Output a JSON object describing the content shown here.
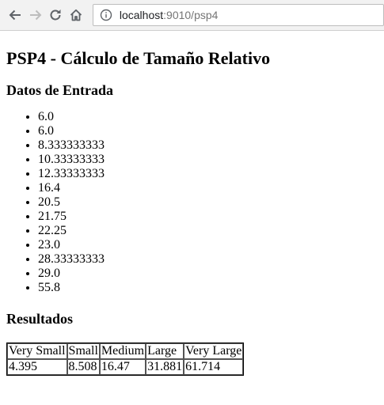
{
  "browser": {
    "url_host": "localhost",
    "url_rest": ":9010/psp4"
  },
  "page": {
    "title": "PSP4 - Cálculo de Tamaño Relativo",
    "input_heading": "Datos de Entrada",
    "inputs": [
      "6.0",
      "6.0",
      "8.333333333",
      "10.33333333",
      "12.33333333",
      "16.4",
      "20.5",
      "21.75",
      "22.25",
      "23.0",
      "28.33333333",
      "29.0",
      "55.8"
    ],
    "results_heading": "Resultados",
    "results": {
      "headers": [
        "Very Small",
        "Small",
        "Medium",
        "Large",
        "Very Large"
      ],
      "values": [
        "4.395",
        "8.508",
        "16.47",
        "31.881",
        "61.714"
      ]
    }
  }
}
